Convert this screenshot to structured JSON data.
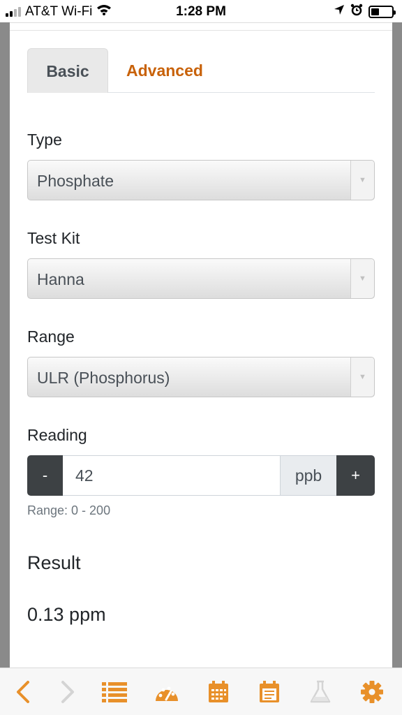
{
  "status_bar": {
    "carrier": "AT&T Wi-Fi",
    "time": "1:28 PM",
    "icons": [
      "signal-icon",
      "wifi-icon",
      "location-icon",
      "alarm-icon",
      "battery-icon"
    ]
  },
  "tabs": [
    {
      "label": "Basic",
      "active": true
    },
    {
      "label": "Advanced",
      "active": false
    }
  ],
  "form": {
    "type": {
      "label": "Type",
      "value": "Phosphate"
    },
    "test_kit": {
      "label": "Test Kit",
      "value": "Hanna"
    },
    "range": {
      "label": "Range",
      "value": "ULR (Phosphorus)"
    },
    "reading": {
      "label": "Reading",
      "minus_label": "-",
      "value": "42",
      "unit": "ppb",
      "plus_label": "+",
      "help": "Range: 0 - 200"
    }
  },
  "result": {
    "title": "Result",
    "value": "0.13 ppm"
  },
  "toolbar": {
    "icons": [
      "back-icon",
      "forward-icon",
      "list-icon",
      "palette-icon",
      "calendar-icon",
      "notes-icon",
      "flask-icon",
      "settings-icon"
    ]
  },
  "colors": {
    "accent": "#e8902a",
    "tab_active_text": "#c8620a",
    "dark_button": "#3d4144"
  }
}
